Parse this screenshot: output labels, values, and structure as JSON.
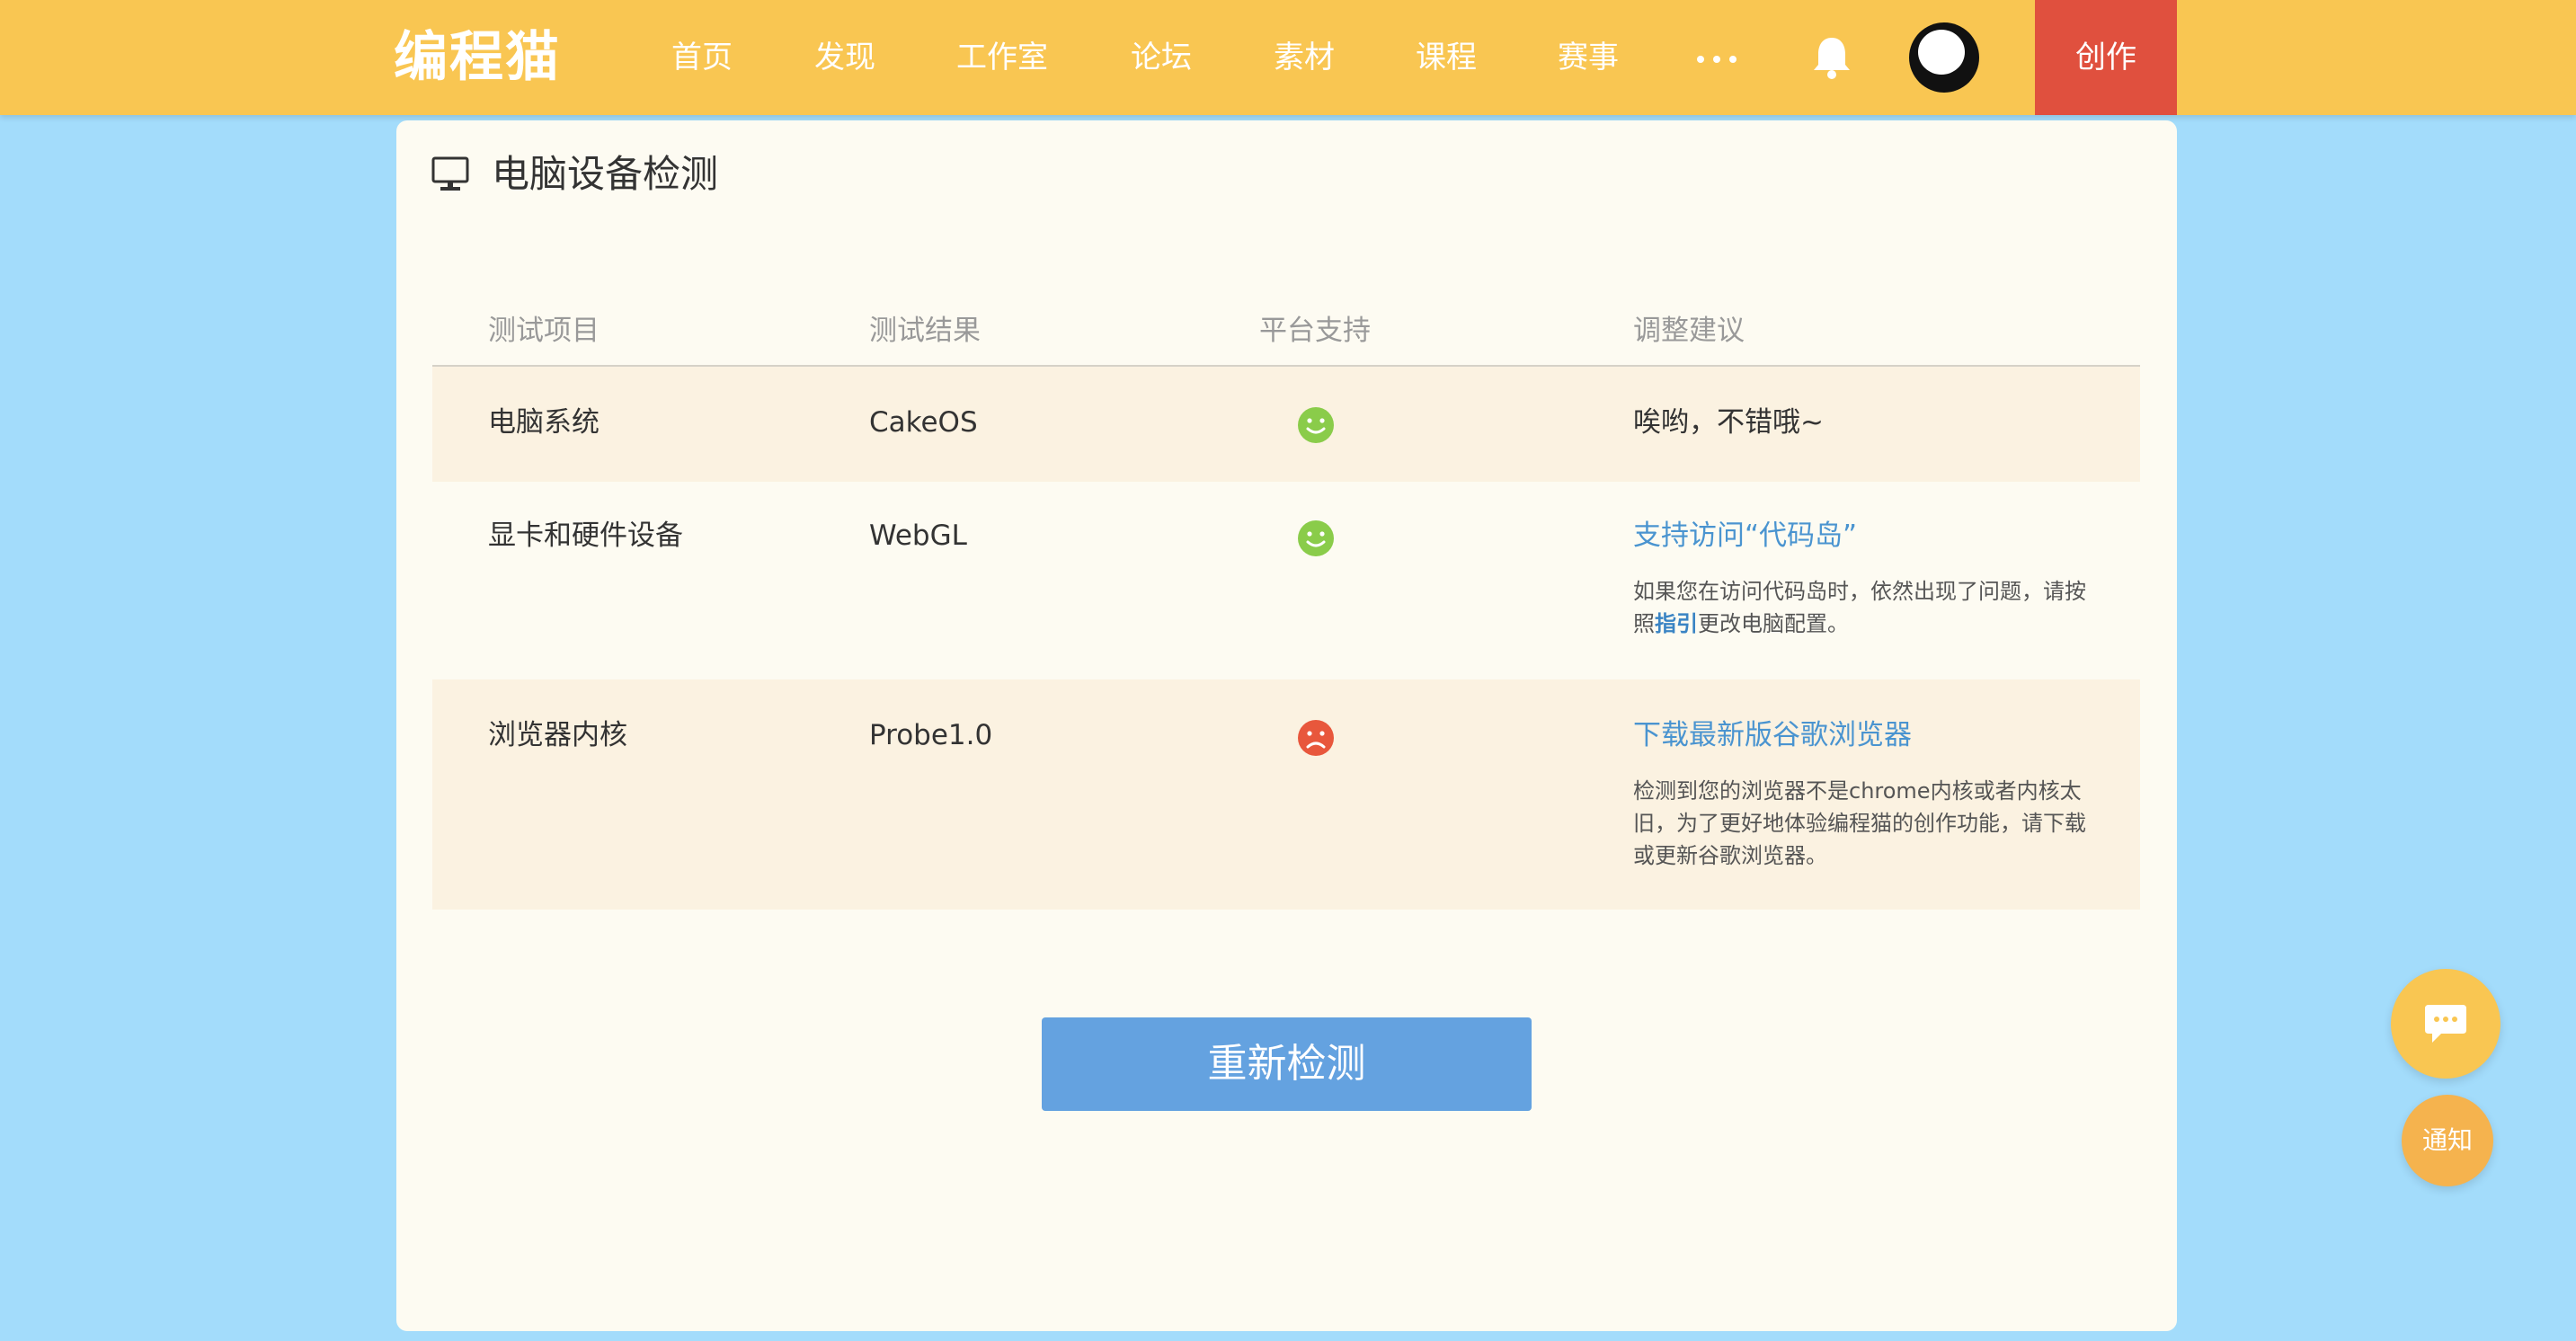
{
  "header": {
    "logo": "编程猫",
    "nav": [
      "首页",
      "发现",
      "工作室",
      "论坛",
      "素材",
      "课程",
      "赛事"
    ],
    "create_label": "创作"
  },
  "page": {
    "title": "电脑设备检测",
    "columns": [
      "测试项目",
      "测试结果",
      "平台支持",
      "调整建议"
    ],
    "rows": [
      {
        "item": "电脑系统",
        "result": "CakeOS",
        "support": "ok",
        "advice": "唉哟，不错哦~"
      },
      {
        "item": "显卡和硬件设备",
        "result": "WebGL",
        "support": "ok",
        "advice_link": "支持访问“代码岛”",
        "desc_pre": "如果您在访问代码岛时，依然出现了问题，请按照",
        "desc_link": "指引",
        "desc_post": "更改电脑配置。"
      },
      {
        "item": "浏览器内核",
        "result": "Probe1.0",
        "support": "bad",
        "advice_link": "下载最新版谷歌浏览器",
        "desc": "检测到您的浏览器不是chrome内核或者内核太旧，为了更好地体验编程猫的创作功能，请下载或更新谷歌浏览器。"
      }
    ],
    "recheck_label": "重新检测"
  },
  "float": {
    "notify_label": "通知"
  },
  "colors": {
    "topbar": "#f9c652",
    "create": "#e0503e",
    "background": "#a3dcfb",
    "card": "#fdfbf2",
    "row_alt": "#fbf2e1",
    "ok": "#8acc4a",
    "bad": "#e8573c",
    "link": "#4a94d0",
    "button": "#64a2e0"
  },
  "icons": {
    "bell": "bell-icon",
    "more": "more-dots-icon",
    "monitor": "monitor-icon",
    "ok_face": "smile-face-icon",
    "bad_face": "sad-face-icon",
    "chat": "chat-bubble-icon"
  }
}
